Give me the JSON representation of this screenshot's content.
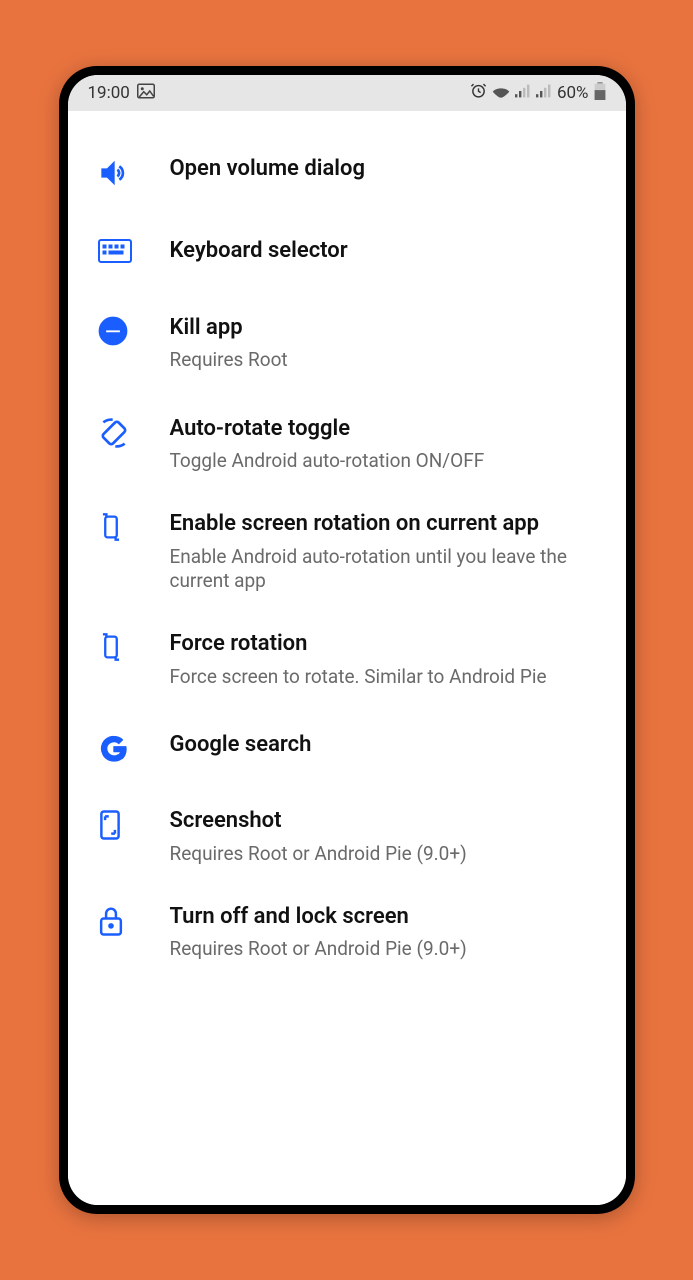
{
  "status": {
    "time": "19:00",
    "battery_pct": "60%"
  },
  "items": [
    {
      "title": "Open volume dialog",
      "subtitle": ""
    },
    {
      "title": "Keyboard selector",
      "subtitle": ""
    },
    {
      "title": "Kill app",
      "subtitle": "Requires Root"
    },
    {
      "title": "Auto-rotate toggle",
      "subtitle": "Toggle Android auto-rotation ON/OFF"
    },
    {
      "title": "Enable screen rotation on current app",
      "subtitle": "Enable Android auto-rotation until you leave the current app"
    },
    {
      "title": "Force rotation",
      "subtitle": "Force screen to rotate. Similar to Android Pie"
    },
    {
      "title": "Google search",
      "subtitle": ""
    },
    {
      "title": "Screenshot",
      "subtitle": "Requires Root or Android Pie (9.0+)"
    },
    {
      "title": "Turn off and lock screen",
      "subtitle": "Requires Root or Android Pie (9.0+)"
    }
  ]
}
